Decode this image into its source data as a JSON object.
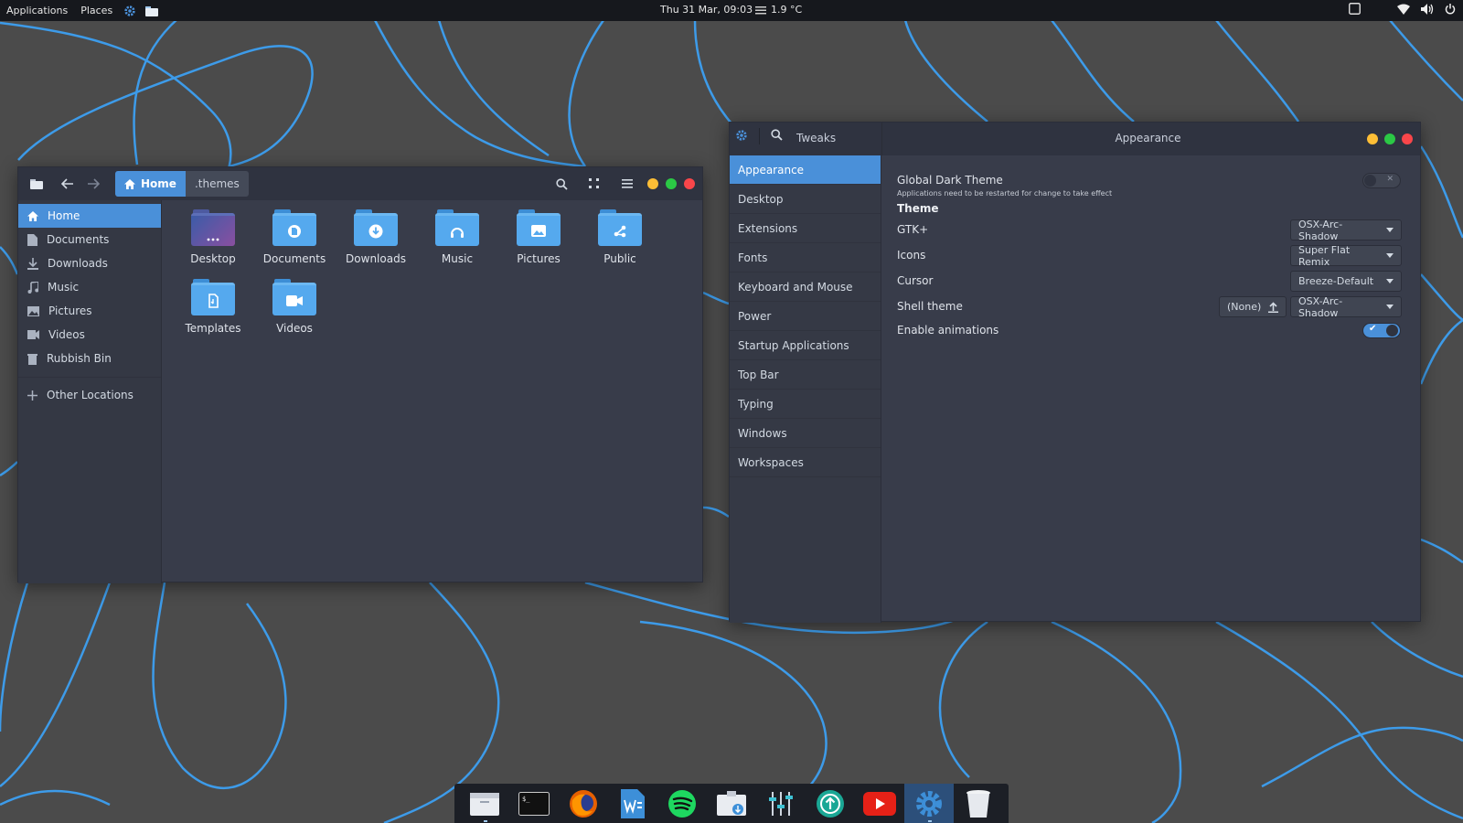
{
  "topbar": {
    "applications": "Applications",
    "places": "Places",
    "clock": "Thu 31 Mar, 09:03",
    "temperature": "1.9 °C"
  },
  "file_manager": {
    "path": {
      "home": "Home",
      "current": ".themes"
    },
    "sidebar": [
      {
        "label": "Home",
        "icon": "home-icon",
        "active": true
      },
      {
        "label": "Documents",
        "icon": "document-icon"
      },
      {
        "label": "Downloads",
        "icon": "download-icon"
      },
      {
        "label": "Music",
        "icon": "music-icon"
      },
      {
        "label": "Pictures",
        "icon": "picture-icon"
      },
      {
        "label": "Videos",
        "icon": "video-icon"
      },
      {
        "label": "Rubbish Bin",
        "icon": "trash-icon"
      },
      {
        "label": "Other Locations",
        "icon": "plus-icon"
      }
    ],
    "folders": [
      {
        "label": "Desktop",
        "icon": "desktop-folder-icon"
      },
      {
        "label": "Documents",
        "icon": "documents-folder-icon"
      },
      {
        "label": "Downloads",
        "icon": "downloads-folder-icon"
      },
      {
        "label": "Music",
        "icon": "music-folder-icon"
      },
      {
        "label": "Pictures",
        "icon": "pictures-folder-icon"
      },
      {
        "label": "Public",
        "icon": "public-folder-icon"
      },
      {
        "label": "Templates",
        "icon": "templates-folder-icon"
      },
      {
        "label": "Videos",
        "icon": "videos-folder-icon"
      }
    ]
  },
  "tweaks": {
    "app_title": "Tweaks",
    "page_title": "Appearance",
    "sidebar": [
      "Appearance",
      "Desktop",
      "Extensions",
      "Fonts",
      "Keyboard and Mouse",
      "Power",
      "Startup Applications",
      "Top Bar",
      "Typing",
      "Windows",
      "Workspaces"
    ],
    "global_dark_theme": {
      "label": "Global Dark Theme",
      "note": "Applications need to be restarted for change to take effect",
      "enabled": false
    },
    "theme_header": "Theme",
    "gtk": {
      "label": "GTK+",
      "value": "OSX-Arc-Shadow"
    },
    "icons": {
      "label": "Icons",
      "value": "Super Flat Remix"
    },
    "cursor": {
      "label": "Cursor",
      "value": "Breeze-Default"
    },
    "shell": {
      "label": "Shell theme",
      "none_label": "(None)",
      "value": "OSX-Arc-Shadow"
    },
    "animations": {
      "label": "Enable animations",
      "enabled": true
    }
  },
  "dock": [
    "files",
    "terminal",
    "firefox",
    "writer",
    "spotify",
    "archive-manager",
    "mixer",
    "update-manager",
    "youtube",
    "settings",
    "trash"
  ],
  "colors": {
    "accent": "#4a90d9",
    "window_bg": "#383c4a",
    "header_bg": "#2f3340",
    "wallpaper": "#4b4b4b",
    "wallpaper_lines": "#3d9be9"
  }
}
